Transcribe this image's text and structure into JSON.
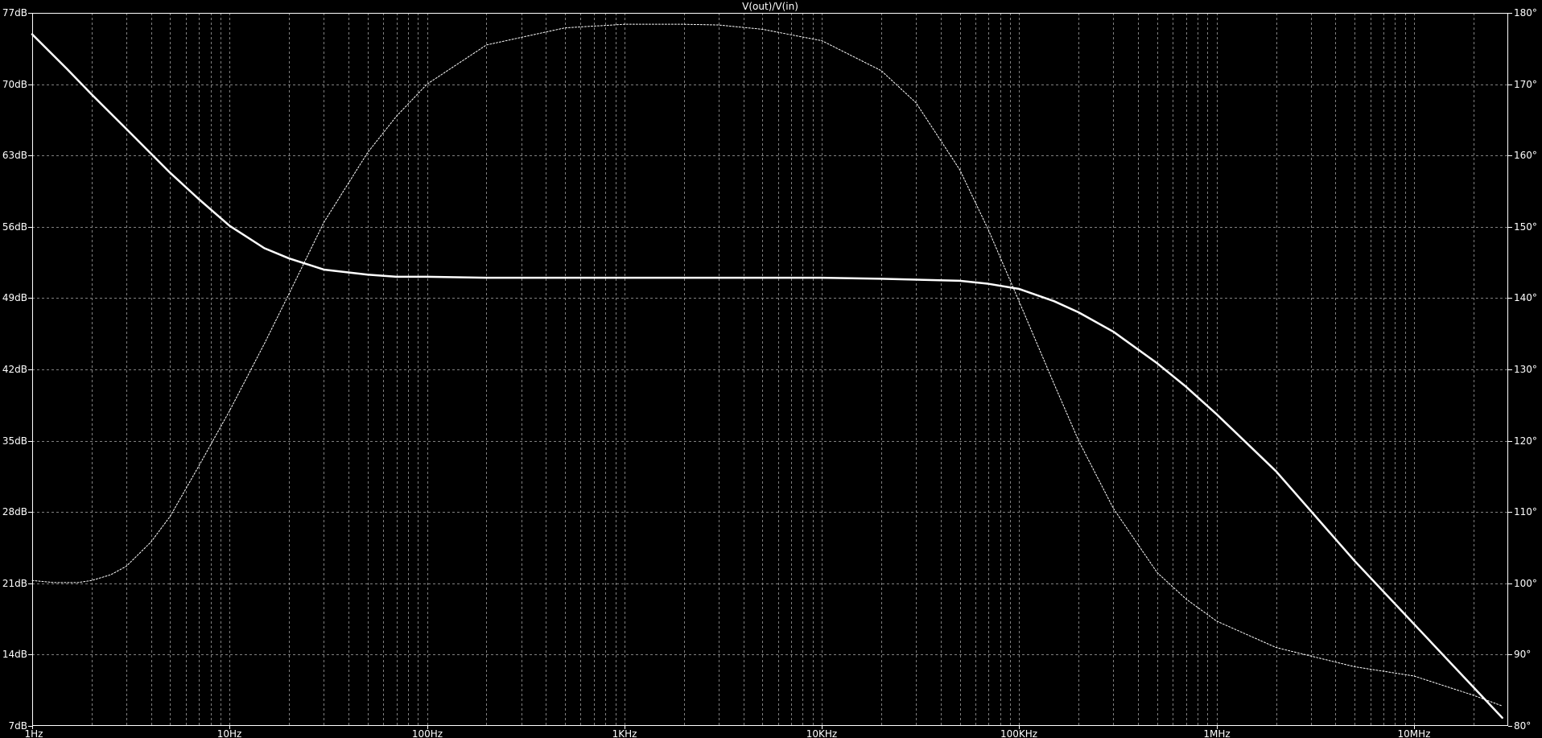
{
  "chart_data": {
    "type": "line",
    "title": "V(out)/V(in)",
    "x_scale": "log",
    "xlim": [
      1,
      30000000
    ],
    "x_tick_values": [
      1,
      10,
      100,
      1000,
      10000,
      100000,
      1000000,
      10000000
    ],
    "x_tick_labels": [
      "1Hz",
      "10Hz",
      "100Hz",
      "1KHz",
      "10KHz",
      "100KHz",
      "1MHz",
      "10MHz"
    ],
    "y_left": {
      "unit": "dB",
      "ylim": [
        7,
        77
      ],
      "tick_values": [
        7,
        14,
        21,
        28,
        35,
        42,
        49,
        56,
        63,
        70,
        77
      ],
      "tick_labels": [
        "7dB",
        "14dB",
        "21dB",
        "28dB",
        "35dB",
        "42dB",
        "49dB",
        "56dB",
        "63dB",
        "70dB",
        "77dB"
      ]
    },
    "y_right": {
      "unit": "°",
      "ylim": [
        80,
        180
      ],
      "tick_values": [
        80,
        90,
        100,
        110,
        120,
        130,
        140,
        150,
        160,
        170,
        180
      ],
      "tick_labels": [
        "80°",
        "90°",
        "100°",
        "110°",
        "120°",
        "130°",
        "140°",
        "150°",
        "160°",
        "170°",
        "180°"
      ]
    },
    "grid": true,
    "colors": {
      "background": "#000000",
      "grid": "#808080",
      "axes": "#ffffff",
      "text": "#ffffff",
      "trace": "#ffffff"
    },
    "series": [
      {
        "style": "solid",
        "axis": "left",
        "x": [
          1,
          1.5,
          2,
          3,
          5,
          7,
          10,
          15,
          20,
          30,
          50,
          70,
          100,
          200,
          500,
          1000,
          2000,
          5000,
          10000,
          20000,
          50000,
          70000,
          100000,
          150000,
          200000,
          300000,
          500000,
          700000,
          1000000,
          2000000,
          5000000,
          10000000,
          20000000,
          28000000
        ],
        "y": [
          74.9,
          71.5,
          69.0,
          65.6,
          61.3,
          58.7,
          56.1,
          53.9,
          52.9,
          51.8,
          51.3,
          51.1,
          51.1,
          51.0,
          51.0,
          51.0,
          51.0,
          51.0,
          51.0,
          50.9,
          50.7,
          50.4,
          49.9,
          48.7,
          47.6,
          45.7,
          42.6,
          40.3,
          37.6,
          32.0,
          23.2,
          17.0,
          10.8,
          7.8
        ]
      },
      {
        "style": "dotted",
        "axis": "right",
        "x": [
          1,
          1.3,
          1.7,
          2,
          2.5,
          3,
          4,
          5,
          7,
          10,
          15,
          20,
          30,
          50,
          70,
          100,
          200,
          500,
          1000,
          2000,
          3000,
          5000,
          10000,
          20000,
          30000,
          50000,
          70000,
          100000,
          150000,
          200000,
          300000,
          500000,
          700000,
          1000000,
          2000000,
          5000000,
          10000000,
          20000000,
          28000000
        ],
        "y": [
          100.4,
          100.1,
          100.1,
          100.4,
          101.2,
          102.4,
          105.8,
          109.4,
          116.5,
          124.2,
          133.6,
          140.6,
          150.6,
          160.4,
          165.5,
          170.0,
          175.5,
          177.9,
          178.4,
          178.4,
          178.3,
          177.7,
          176.1,
          171.9,
          167.4,
          158.0,
          149.5,
          139.5,
          128.0,
          120.0,
          110.5,
          101.5,
          97.8,
          94.7,
          91.0,
          88.3,
          87.0,
          84.3,
          82.8
        ]
      }
    ]
  }
}
